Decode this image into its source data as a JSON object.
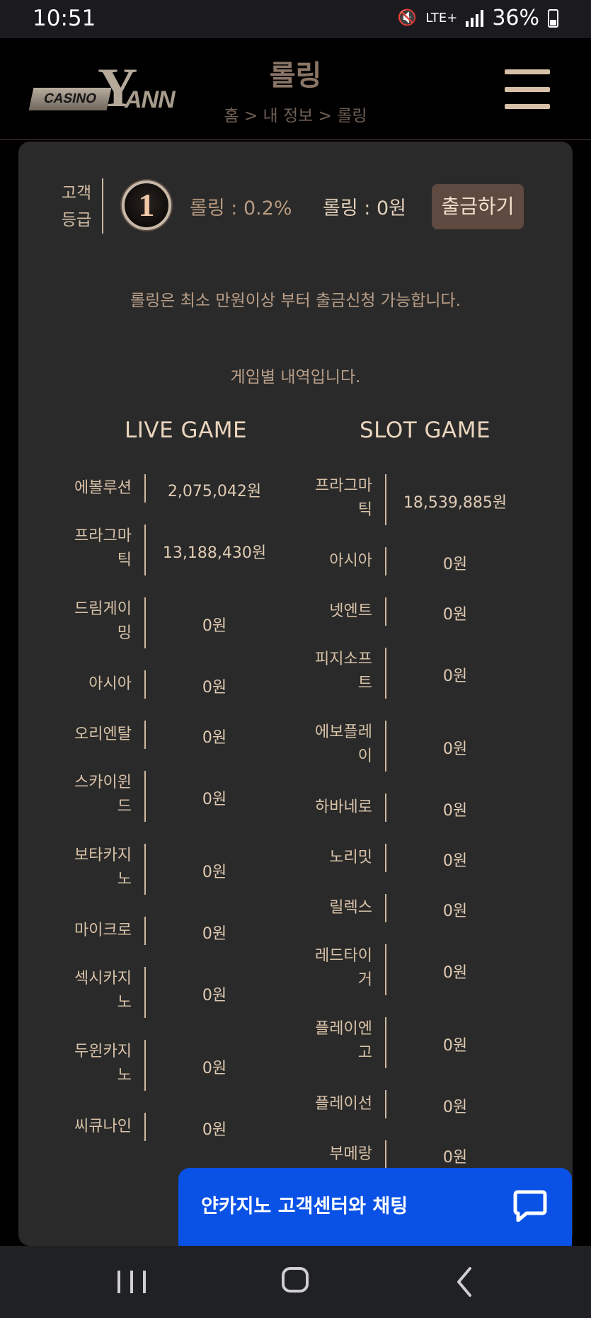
{
  "status": {
    "time": "10:51",
    "network": "LTE+",
    "battery": "36%"
  },
  "header": {
    "logo_casino": "CASINO",
    "logo_y": "Y",
    "logo_ann": "ANN",
    "title": "롤링",
    "breadcrumb": "홈 > 내 정보 > 롤링"
  },
  "grade": {
    "label_line1": "고객",
    "label_line2": "등급",
    "level": "1",
    "rolling_rate": "롤링 : 0.2%",
    "rolling_amount": "롤링 : 0원",
    "withdraw_label": "출금하기"
  },
  "notice": "롤링은 최소 만원이상 부터 출금신청 가능합니다.",
  "history_title": "게임별 내역입니다.",
  "live_game": {
    "title": "LIVE GAME",
    "rows": [
      {
        "name_lines": [
          "에볼루션"
        ],
        "value": "2,075,042원"
      },
      {
        "name_lines": [
          "프라그마",
          "틱"
        ],
        "value": "13,188,430원"
      },
      {
        "name_lines": [
          "드림게이",
          "밍"
        ],
        "value": "0원"
      },
      {
        "name_lines": [
          "아시아"
        ],
        "value": "0원"
      },
      {
        "name_lines": [
          "오리엔탈"
        ],
        "value": "0원"
      },
      {
        "name_lines": [
          "스카이윈",
          "드"
        ],
        "value": "0원"
      },
      {
        "name_lines": [
          "보타카지",
          "노"
        ],
        "value": "0원"
      },
      {
        "name_lines": [
          "마이크로"
        ],
        "value": "0원"
      },
      {
        "name_lines": [
          "섹시카지",
          "노"
        ],
        "value": "0원"
      },
      {
        "name_lines": [
          "두윈카지",
          "노"
        ],
        "value": "0원"
      },
      {
        "name_lines": [
          "씨큐나인"
        ],
        "value": "0원"
      }
    ]
  },
  "slot_game": {
    "title": "SLOT GAME",
    "rows": [
      {
        "name_lines": [
          "프라그마",
          "틱"
        ],
        "value": "18,539,885원"
      },
      {
        "name_lines": [
          "아시아"
        ],
        "value": "0원"
      },
      {
        "name_lines": [
          "넷엔트"
        ],
        "value": "0원"
      },
      {
        "name_lines": [
          "피지소프",
          "트"
        ],
        "value": "0원"
      },
      {
        "name_lines": [
          "에보플레",
          "이"
        ],
        "value": "0원"
      },
      {
        "name_lines": [
          "하바네로"
        ],
        "value": "0원"
      },
      {
        "name_lines": [
          "노리밋"
        ],
        "value": "0원"
      },
      {
        "name_lines": [
          "릴렉스"
        ],
        "value": "0원"
      },
      {
        "name_lines": [
          "레드타이",
          "거"
        ],
        "value": "0원"
      },
      {
        "name_lines": [
          "플레이엔",
          "고"
        ],
        "value": "0원"
      },
      {
        "name_lines": [
          "플레이선"
        ],
        "value": "0원"
      },
      {
        "name_lines": [
          "부메랑"
        ],
        "value": "0원"
      }
    ]
  },
  "chat": {
    "label": "얀카지노 고객센터와 채팅",
    "icon": "chat-bubble-icon"
  },
  "colors": {
    "accent": "#5e4a40",
    "chat": "#0a52e6",
    "text": "#d8c2a8",
    "card": "#2a2a2a"
  }
}
